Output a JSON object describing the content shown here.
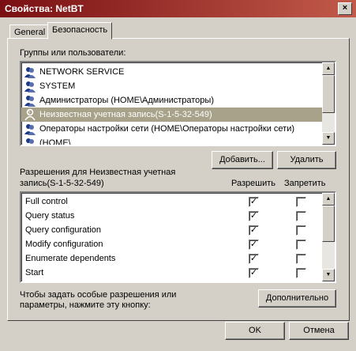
{
  "window": {
    "title": "Свойства: NetBT",
    "close_glyph": "×"
  },
  "tabs": [
    {
      "label": "General"
    },
    {
      "label": "Безопасность",
      "active": true
    }
  ],
  "groups": {
    "label": "Группы или пользователи:",
    "items": [
      {
        "label": "NETWORK SERVICE",
        "icon": "group-icon"
      },
      {
        "label": "SYSTEM",
        "icon": "group-icon"
      },
      {
        "label": "Администраторы (HOME\\Администраторы)",
        "icon": "group-icon"
      },
      {
        "label": "Неизвестная учетная запись(S-1-5-32-549)",
        "icon": "unknown-user-icon",
        "selected": true
      },
      {
        "label": "Операторы настройки сети (HOME\\Операторы настройки сети)",
        "icon": "group-icon"
      },
      {
        "label": "                              (HOME\\           ",
        "icon": "group-icon"
      }
    ]
  },
  "buttons": {
    "add": "Добавить...",
    "remove": "Удалить",
    "advanced": "Дополнительно",
    "ok": "OK",
    "cancel": "Отмена"
  },
  "permissions": {
    "label_line1": "Разрешения для Неизвестная учетная",
    "label_line2": "запись(S-1-5-32-549)",
    "allow_header": "Разрешить",
    "deny_header": "Запретить",
    "rows": [
      {
        "name": "Full control",
        "allow": true,
        "deny": false
      },
      {
        "name": "Query status",
        "allow": true,
        "deny": false
      },
      {
        "name": "Query configuration",
        "allow": true,
        "deny": false
      },
      {
        "name": "Modify configuration",
        "allow": true,
        "deny": false
      },
      {
        "name": "Enumerate dependents",
        "allow": true,
        "deny": false
      },
      {
        "name": "Start",
        "allow": true,
        "deny": false
      }
    ]
  },
  "advanced_hint": {
    "line1": "Чтобы задать особые разрешения или",
    "line2": "параметры, нажмите эту кнопку:"
  }
}
